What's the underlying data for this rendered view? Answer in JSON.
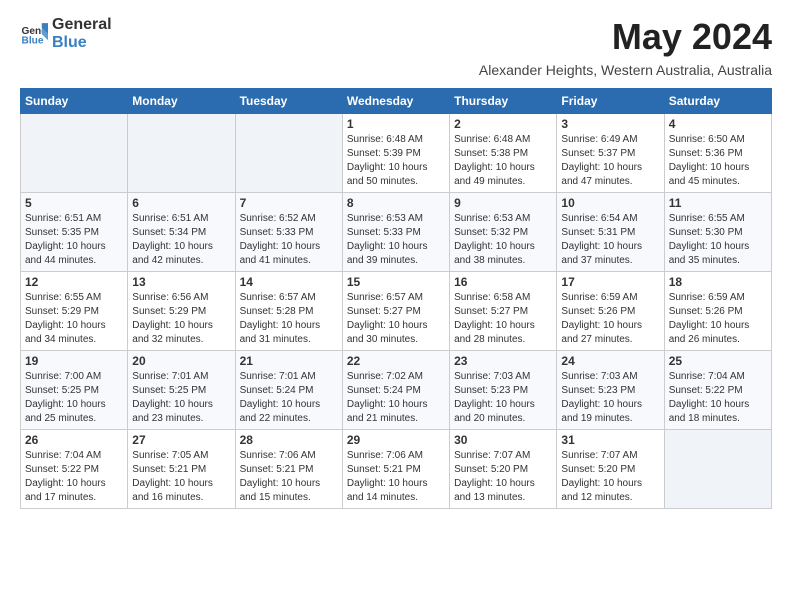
{
  "logo": {
    "general": "General",
    "blue": "Blue"
  },
  "title": "May 2024",
  "subtitle": "Alexander Heights, Western Australia, Australia",
  "days_of_week": [
    "Sunday",
    "Monday",
    "Tuesday",
    "Wednesday",
    "Thursday",
    "Friday",
    "Saturday"
  ],
  "weeks": [
    [
      {
        "day": "",
        "info": ""
      },
      {
        "day": "",
        "info": ""
      },
      {
        "day": "",
        "info": ""
      },
      {
        "day": "1",
        "info": "Sunrise: 6:48 AM\nSunset: 5:39 PM\nDaylight: 10 hours\nand 50 minutes."
      },
      {
        "day": "2",
        "info": "Sunrise: 6:48 AM\nSunset: 5:38 PM\nDaylight: 10 hours\nand 49 minutes."
      },
      {
        "day": "3",
        "info": "Sunrise: 6:49 AM\nSunset: 5:37 PM\nDaylight: 10 hours\nand 47 minutes."
      },
      {
        "day": "4",
        "info": "Sunrise: 6:50 AM\nSunset: 5:36 PM\nDaylight: 10 hours\nand 45 minutes."
      }
    ],
    [
      {
        "day": "5",
        "info": "Sunrise: 6:51 AM\nSunset: 5:35 PM\nDaylight: 10 hours\nand 44 minutes."
      },
      {
        "day": "6",
        "info": "Sunrise: 6:51 AM\nSunset: 5:34 PM\nDaylight: 10 hours\nand 42 minutes."
      },
      {
        "day": "7",
        "info": "Sunrise: 6:52 AM\nSunset: 5:33 PM\nDaylight: 10 hours\nand 41 minutes."
      },
      {
        "day": "8",
        "info": "Sunrise: 6:53 AM\nSunset: 5:33 PM\nDaylight: 10 hours\nand 39 minutes."
      },
      {
        "day": "9",
        "info": "Sunrise: 6:53 AM\nSunset: 5:32 PM\nDaylight: 10 hours\nand 38 minutes."
      },
      {
        "day": "10",
        "info": "Sunrise: 6:54 AM\nSunset: 5:31 PM\nDaylight: 10 hours\nand 37 minutes."
      },
      {
        "day": "11",
        "info": "Sunrise: 6:55 AM\nSunset: 5:30 PM\nDaylight: 10 hours\nand 35 minutes."
      }
    ],
    [
      {
        "day": "12",
        "info": "Sunrise: 6:55 AM\nSunset: 5:29 PM\nDaylight: 10 hours\nand 34 minutes."
      },
      {
        "day": "13",
        "info": "Sunrise: 6:56 AM\nSunset: 5:29 PM\nDaylight: 10 hours\nand 32 minutes."
      },
      {
        "day": "14",
        "info": "Sunrise: 6:57 AM\nSunset: 5:28 PM\nDaylight: 10 hours\nand 31 minutes."
      },
      {
        "day": "15",
        "info": "Sunrise: 6:57 AM\nSunset: 5:27 PM\nDaylight: 10 hours\nand 30 minutes."
      },
      {
        "day": "16",
        "info": "Sunrise: 6:58 AM\nSunset: 5:27 PM\nDaylight: 10 hours\nand 28 minutes."
      },
      {
        "day": "17",
        "info": "Sunrise: 6:59 AM\nSunset: 5:26 PM\nDaylight: 10 hours\nand 27 minutes."
      },
      {
        "day": "18",
        "info": "Sunrise: 6:59 AM\nSunset: 5:26 PM\nDaylight: 10 hours\nand 26 minutes."
      }
    ],
    [
      {
        "day": "19",
        "info": "Sunrise: 7:00 AM\nSunset: 5:25 PM\nDaylight: 10 hours\nand 25 minutes."
      },
      {
        "day": "20",
        "info": "Sunrise: 7:01 AM\nSunset: 5:25 PM\nDaylight: 10 hours\nand 23 minutes."
      },
      {
        "day": "21",
        "info": "Sunrise: 7:01 AM\nSunset: 5:24 PM\nDaylight: 10 hours\nand 22 minutes."
      },
      {
        "day": "22",
        "info": "Sunrise: 7:02 AM\nSunset: 5:24 PM\nDaylight: 10 hours\nand 21 minutes."
      },
      {
        "day": "23",
        "info": "Sunrise: 7:03 AM\nSunset: 5:23 PM\nDaylight: 10 hours\nand 20 minutes."
      },
      {
        "day": "24",
        "info": "Sunrise: 7:03 AM\nSunset: 5:23 PM\nDaylight: 10 hours\nand 19 minutes."
      },
      {
        "day": "25",
        "info": "Sunrise: 7:04 AM\nSunset: 5:22 PM\nDaylight: 10 hours\nand 18 minutes."
      }
    ],
    [
      {
        "day": "26",
        "info": "Sunrise: 7:04 AM\nSunset: 5:22 PM\nDaylight: 10 hours\nand 17 minutes."
      },
      {
        "day": "27",
        "info": "Sunrise: 7:05 AM\nSunset: 5:21 PM\nDaylight: 10 hours\nand 16 minutes."
      },
      {
        "day": "28",
        "info": "Sunrise: 7:06 AM\nSunset: 5:21 PM\nDaylight: 10 hours\nand 15 minutes."
      },
      {
        "day": "29",
        "info": "Sunrise: 7:06 AM\nSunset: 5:21 PM\nDaylight: 10 hours\nand 14 minutes."
      },
      {
        "day": "30",
        "info": "Sunrise: 7:07 AM\nSunset: 5:20 PM\nDaylight: 10 hours\nand 13 minutes."
      },
      {
        "day": "31",
        "info": "Sunrise: 7:07 AM\nSunset: 5:20 PM\nDaylight: 10 hours\nand 12 minutes."
      },
      {
        "day": "",
        "info": ""
      }
    ]
  ]
}
